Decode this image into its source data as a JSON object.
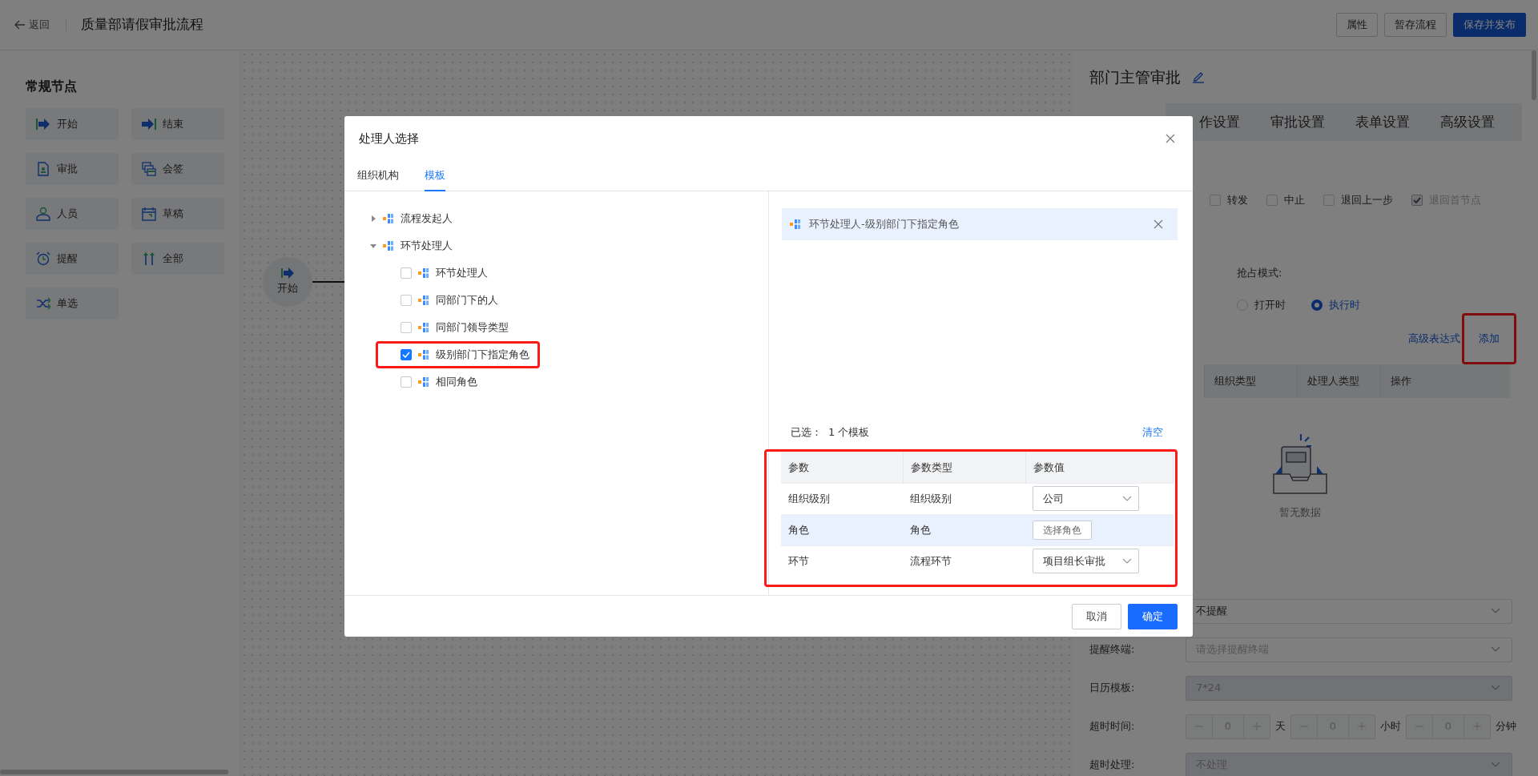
{
  "header": {
    "back": "返回",
    "title": "质量部请假审批流程",
    "buttons": [
      {
        "label": "属性",
        "kind": "default"
      },
      {
        "label": "暂存流程",
        "kind": "default"
      },
      {
        "label": "保存并发布",
        "kind": "primary"
      }
    ]
  },
  "palette": {
    "title": "常规节点",
    "items": [
      {
        "label": "开始",
        "kind": "start"
      },
      {
        "label": "结束",
        "kind": "end"
      },
      {
        "label": "审批",
        "kind": "approve"
      },
      {
        "label": "会签",
        "kind": "countersign"
      },
      {
        "label": "人员",
        "kind": "person"
      },
      {
        "label": "草稿",
        "kind": "draft"
      },
      {
        "label": "提醒",
        "kind": "remind"
      },
      {
        "label": "全部",
        "kind": "all"
      },
      {
        "label": "单选",
        "kind": "choice"
      }
    ]
  },
  "canvas": {
    "nodes": [
      {
        "label": "开始"
      }
    ]
  },
  "properties": {
    "title": "部门主管审批",
    "tabs": [
      {
        "label": "作设置",
        "selected": false
      },
      {
        "label": "审批设置",
        "selected": false
      },
      {
        "label": "表单设置",
        "selected": false
      },
      {
        "label": "高级设置",
        "selected": false
      }
    ],
    "operations": [
      {
        "label": "转发",
        "checked": false,
        "disabled": false
      },
      {
        "label": "中止",
        "checked": false,
        "disabled": false
      },
      {
        "label": "退回上一步",
        "checked": false,
        "disabled": false
      },
      {
        "label": "退回首节点",
        "checked": true,
        "disabled": true
      }
    ],
    "preempt": {
      "label": "抢占模式:",
      "options": [
        {
          "label": "打开时",
          "selected": false
        },
        {
          "label": "执行时",
          "selected": true
        }
      ]
    },
    "links": [
      {
        "label": "高级表达式",
        "highlighted": false
      },
      {
        "label": "添加",
        "highlighted": true
      }
    ],
    "handler_table": {
      "columns": [
        "组织类型",
        "处理人类型",
        "操作"
      ],
      "empty_text": "暂无数据"
    },
    "fields": [
      {
        "kind": "select",
        "value": "不提醒",
        "disabled": false
      },
      {
        "kind": "select",
        "label": "提醒终端:",
        "placeholder": "请选择提醒终端",
        "disabled": false
      },
      {
        "kind": "select",
        "label": "日历模板:",
        "value": "7*24",
        "disabled": true
      },
      {
        "kind": "duration",
        "label": "超时时间:",
        "disabled": true,
        "parts": [
          {
            "value": "0",
            "unit": "天"
          },
          {
            "value": "0",
            "unit": "小时"
          },
          {
            "value": "0",
            "unit": "分钟"
          }
        ]
      },
      {
        "kind": "select",
        "label": "超时处理:",
        "value": "不处理",
        "disabled": true
      }
    ]
  },
  "dialog": {
    "title": "处理人选择",
    "tabs": [
      {
        "label": "组织机构",
        "selected": false
      },
      {
        "label": "模板",
        "selected": true
      }
    ],
    "tree": [
      {
        "label": "流程发起人",
        "expanded": false
      },
      {
        "label": "环节处理人",
        "expanded": true,
        "children": [
          {
            "label": "环节处理人",
            "checked": false,
            "highlighted": false
          },
          {
            "label": "同部门下的人",
            "checked": false,
            "highlighted": false
          },
          {
            "label": "同部门领导类型",
            "checked": false,
            "highlighted": false
          },
          {
            "label": "级别部门下指定角色",
            "checked": true,
            "highlighted": true
          },
          {
            "label": "相同角色",
            "checked": false,
            "highlighted": false
          }
        ]
      }
    ],
    "selected_items": [
      "环节处理人-级别部门下指定角色"
    ],
    "selected_label": "已选：",
    "selected_count": "1 个模板",
    "clear": "清空",
    "params": {
      "highlighted": true,
      "columns": [
        "参数",
        "参数类型",
        "参数值"
      ],
      "rows": [
        {
          "name": "组织级别",
          "type": "组织级别",
          "kind": "select",
          "value": "公司",
          "hover": false
        },
        {
          "name": "角色",
          "type": "角色",
          "kind": "button",
          "value": "选择角色",
          "hover": true
        },
        {
          "name": "环节",
          "type": "流程环节",
          "kind": "select",
          "value": "项目组长审批",
          "hover": false
        }
      ]
    },
    "buttons": [
      {
        "label": "取消",
        "kind": "default"
      },
      {
        "label": "确定",
        "kind": "primary"
      }
    ]
  }
}
